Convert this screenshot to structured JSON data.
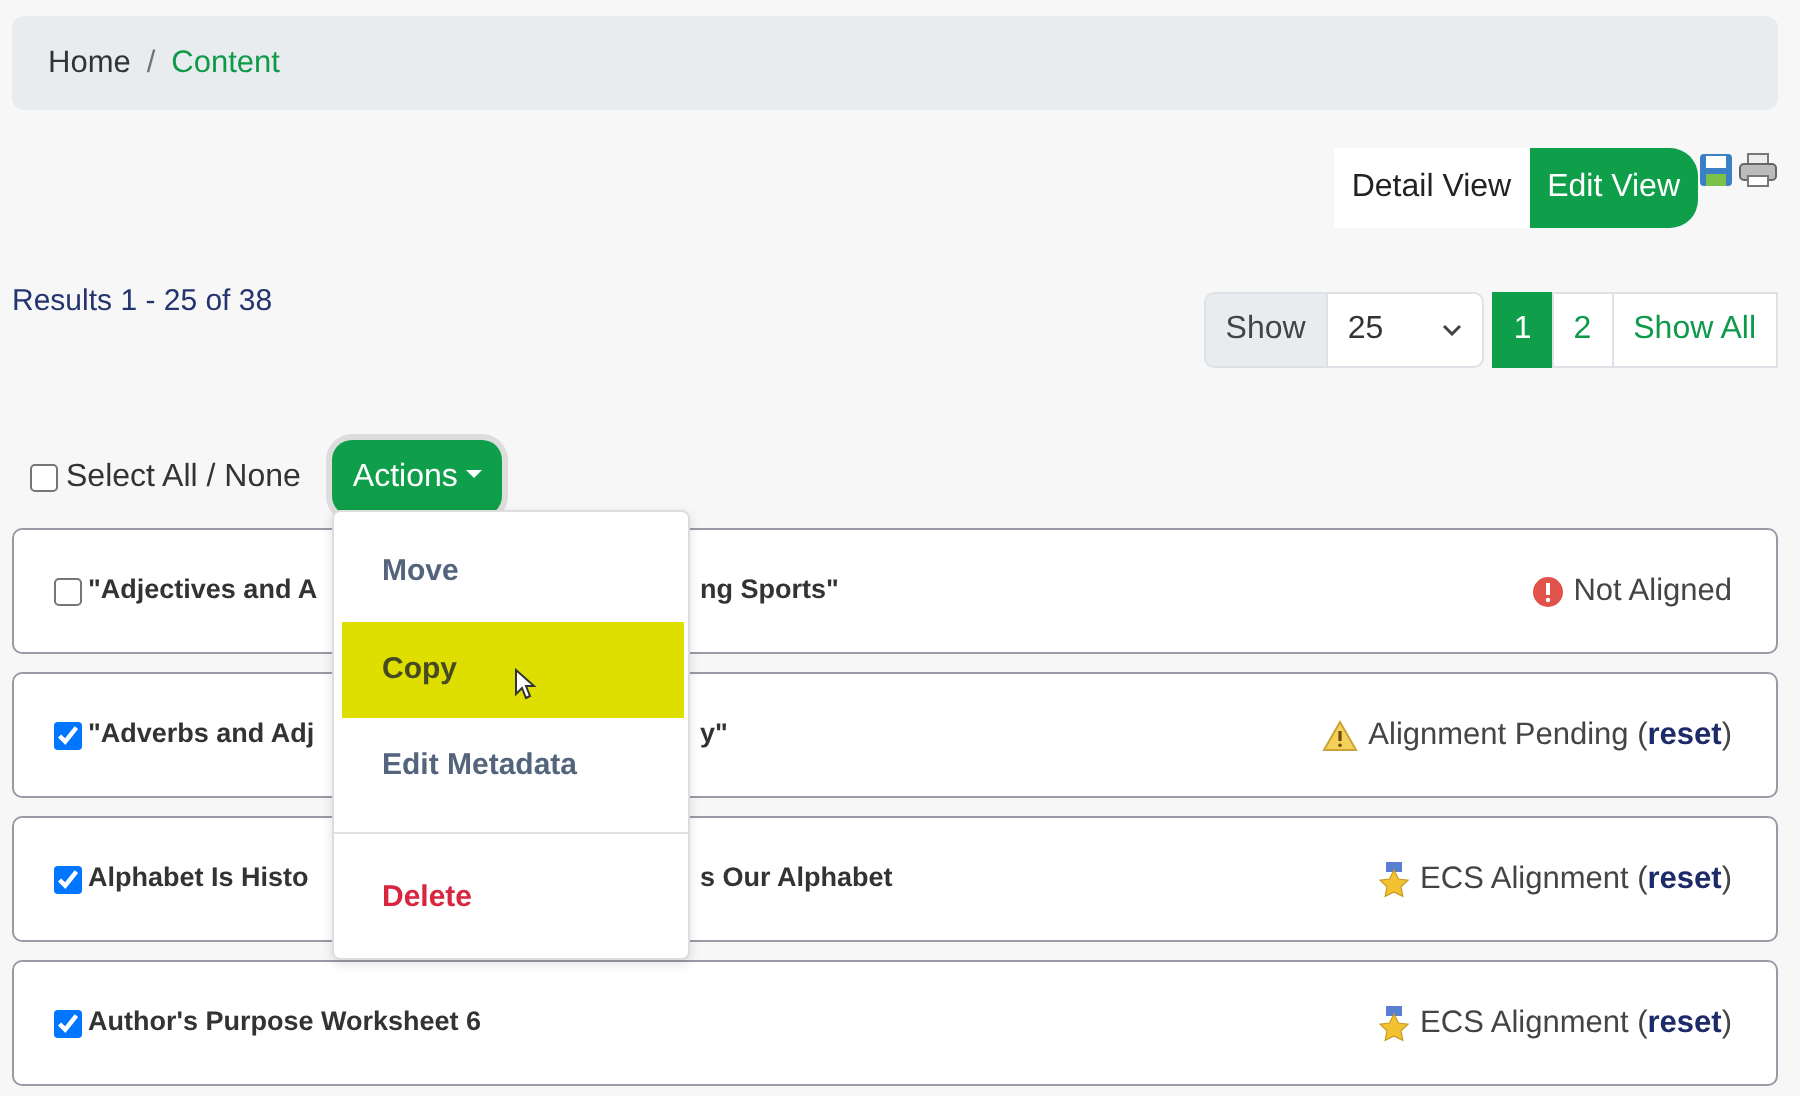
{
  "breadcrumb": [
    {
      "label": "Home",
      "active": false
    },
    {
      "separator": "/",
      "label": "Content",
      "active": true
    }
  ],
  "views": [
    {
      "label": "Detail View",
      "selected": false
    },
    {
      "label": "Edit View",
      "selected": true
    }
  ],
  "results": {
    "prefix": "Results",
    "range": "1 - 25 of 38"
  },
  "page_size": {
    "label": "Show",
    "value": "25"
  },
  "pages": [
    {
      "label": "1",
      "selected": true
    },
    {
      "label": "2",
      "selected": false
    },
    {
      "label": "Show All",
      "selected": false
    }
  ],
  "select_all": {
    "label": "Select All / None",
    "checked": false
  },
  "actions": {
    "label": "Actions",
    "expanded": true,
    "menu": [
      {
        "label": "Move",
        "kind": "item",
        "highlighted": false
      },
      {
        "label": "Copy",
        "kind": "item",
        "highlighted": true
      },
      {
        "label": "Edit Metadata",
        "kind": "item",
        "highlighted": false
      },
      {
        "label": "Delete",
        "kind": "danger",
        "highlighted": false
      }
    ]
  },
  "items": [
    {
      "checked": false,
      "title_start": "\"Adjectives and A",
      "title_end": "ng Sports\"",
      "status": {
        "kind": "not_aligned",
        "label": "Not Aligned"
      }
    },
    {
      "checked": true,
      "title_start": "\"Adverbs and Adj",
      "title_end": "y\"",
      "status": {
        "kind": "pending",
        "label": "Alignment Pending",
        "open": "(",
        "reset": "reset",
        "close": ")"
      }
    },
    {
      "checked": true,
      "title_start": "Alphabet Is Histo",
      "title_end": "s Our Alphabet",
      "status": {
        "kind": "ecs",
        "label": "ECS Alignment",
        "open": "(",
        "reset": "reset",
        "close": ")"
      }
    },
    {
      "checked": true,
      "title_start": "Author's Purpose Worksheet 6",
      "status": {
        "kind": "ecs",
        "label": "ECS Alignment",
        "open": "(",
        "reset": "reset",
        "close": ")"
      }
    }
  ]
}
